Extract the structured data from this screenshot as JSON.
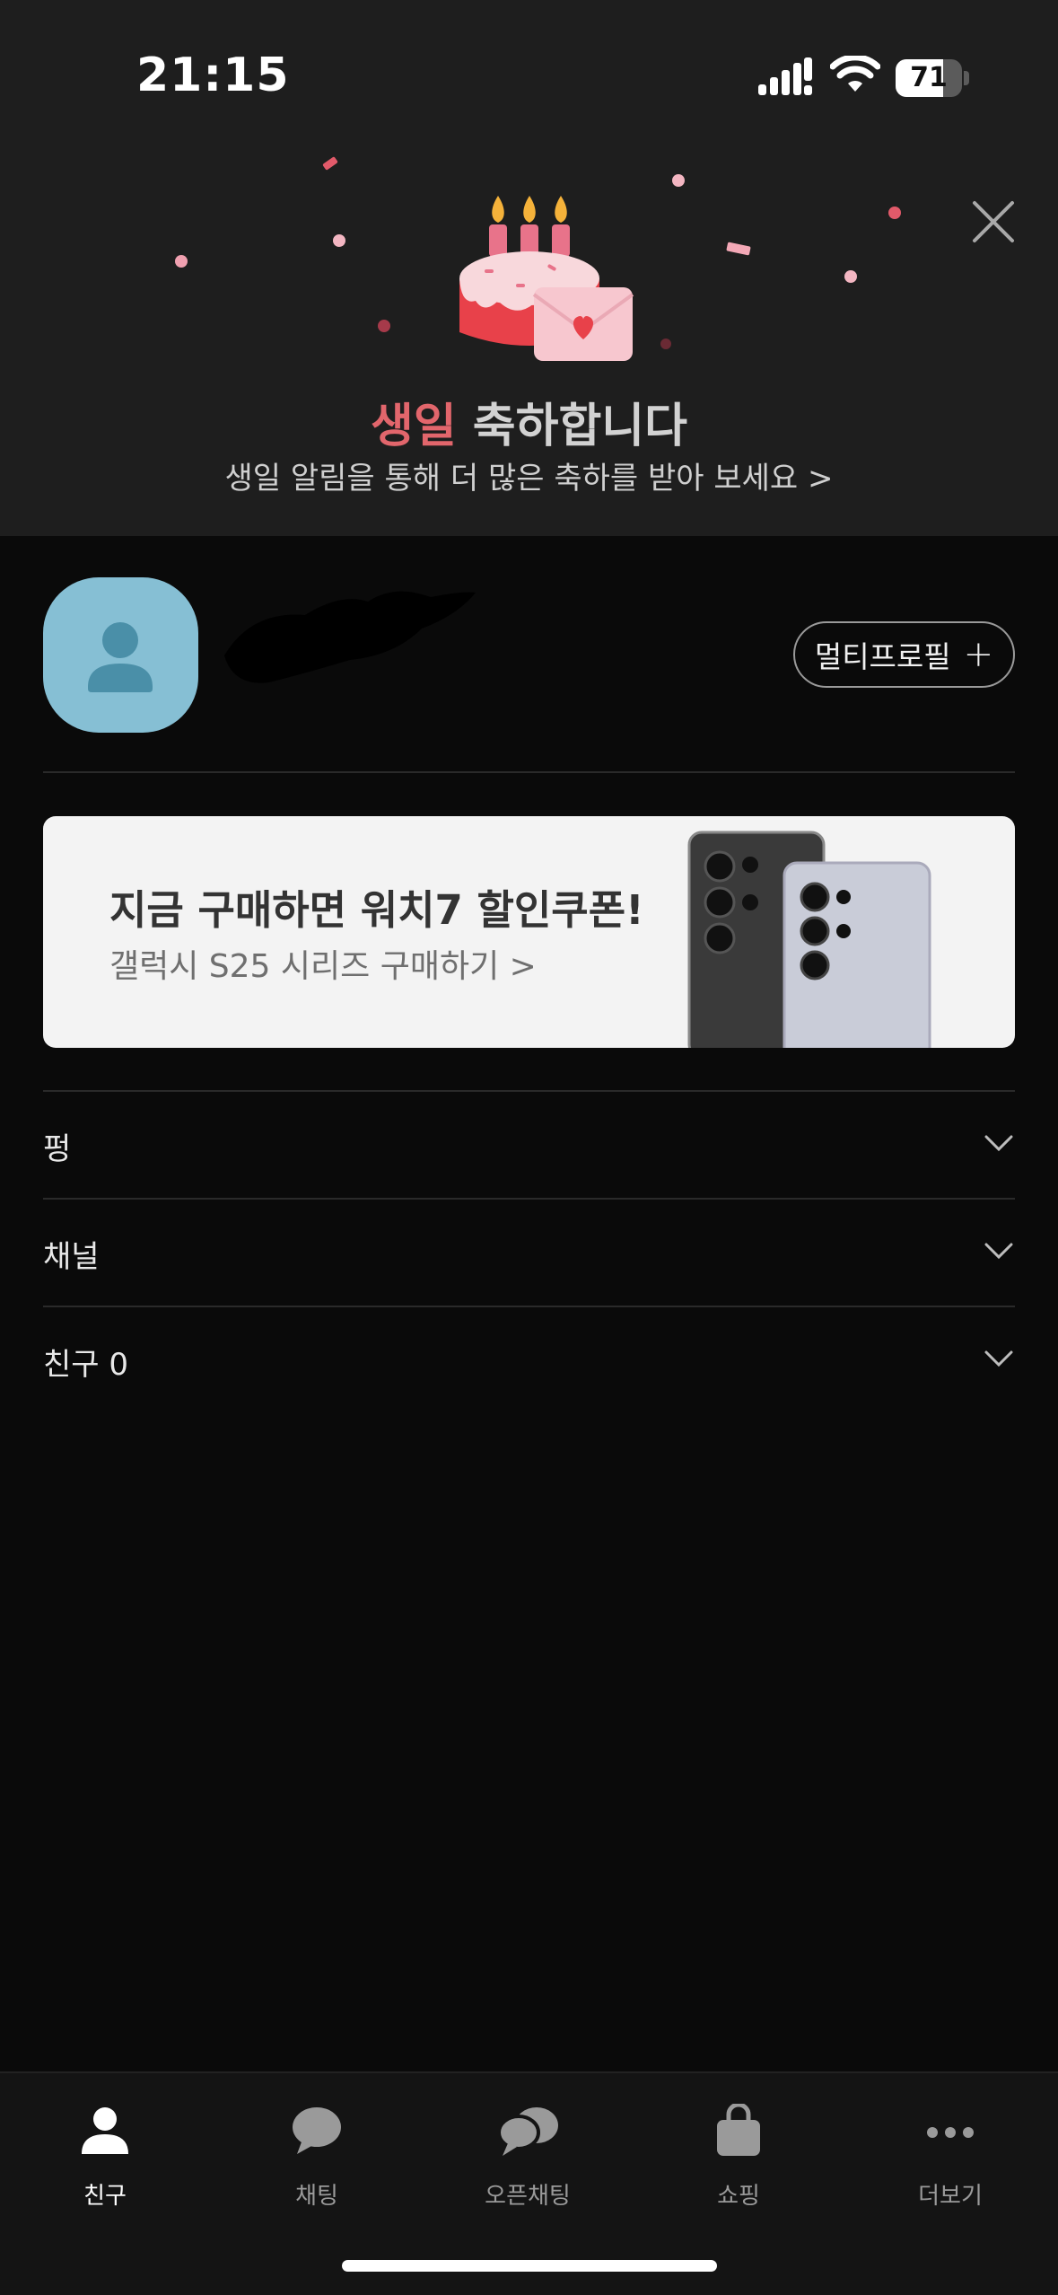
{
  "status_bar": {
    "time": "21:15",
    "battery_level": 71,
    "battery_text": "71"
  },
  "birthday_banner": {
    "title_highlight": "생일",
    "title_rest": " 축하합니다",
    "subtitle": "생일 알림을 통해 더 많은 축하를 받아 보세요 >",
    "highlight_color": "#e2666c",
    "icon": "birthday-cake-icon"
  },
  "profile": {
    "multi_profile_label": "멀티프로필",
    "multi_profile_plus": "+"
  },
  "ad": {
    "title": "지금 구매하면 워치7 할인쿠폰!",
    "subtitle": "갤럭시 S25 시리즈 구매하기 >"
  },
  "sections": [
    {
      "label": "펑"
    },
    {
      "label": "채널"
    },
    {
      "label": "친구 0"
    }
  ],
  "tabbar": {
    "items": [
      {
        "label": "친구",
        "icon": "person-icon",
        "active": true
      },
      {
        "label": "채팅",
        "icon": "chat-bubble-icon",
        "active": false
      },
      {
        "label": "오픈채팅",
        "icon": "open-chat-icon",
        "active": false
      },
      {
        "label": "쇼핑",
        "icon": "shopping-bag-icon",
        "active": false
      },
      {
        "label": "더보기",
        "icon": "more-dots-icon",
        "active": false
      }
    ]
  }
}
